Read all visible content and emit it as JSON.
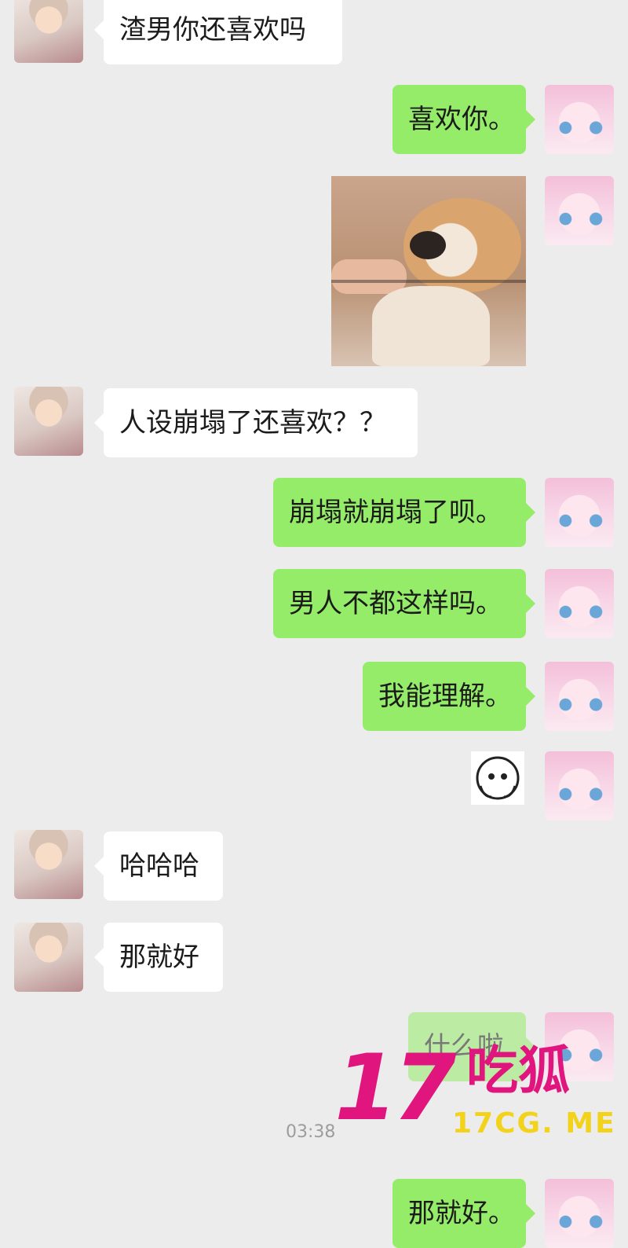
{
  "messages": [
    {
      "side": "left",
      "text": "渣男你还喜欢吗"
    },
    {
      "side": "right",
      "text": "喜欢你。"
    },
    {
      "side": "right",
      "type": "image",
      "alt": "dog photo"
    },
    {
      "side": "left",
      "text": "人设崩塌了还喜欢？？"
    },
    {
      "side": "right",
      "text": "崩塌就崩塌了呗。"
    },
    {
      "side": "right",
      "text": "男人不都这样吗。"
    },
    {
      "side": "right",
      "text": "我能理解。"
    },
    {
      "side": "right",
      "type": "sticker",
      "alt": "sticker"
    },
    {
      "side": "left",
      "text": "哈哈哈"
    },
    {
      "side": "left",
      "text": "那就好"
    },
    {
      "side": "right",
      "text": "什么啦"
    },
    {
      "side": "right",
      "text": "那就好。"
    }
  ],
  "timestamp": "03:38",
  "watermark": {
    "big": "17",
    "cn": "吃狐",
    "site": "17CG. ME"
  },
  "colors": {
    "background": "#ececec",
    "bubble_left": "#ffffff",
    "bubble_right": "#95ec69",
    "watermark_pink": "#e0157e",
    "watermark_yellow": "#f2d21b"
  }
}
